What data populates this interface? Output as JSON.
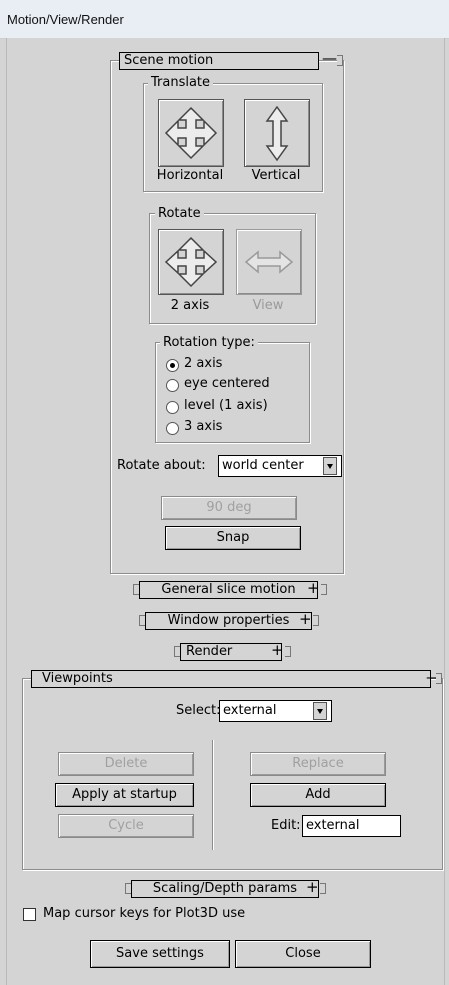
{
  "window": {
    "title": "Motion/View/Render"
  },
  "scene_motion": {
    "header": "Scene motion",
    "toggle": "—",
    "translate": {
      "title": "Translate",
      "horizontal": "Horizontal",
      "vertical": "Vertical"
    },
    "rotate": {
      "title": "Rotate",
      "two_axis": "2 axis",
      "view": "View"
    },
    "rotation_type": {
      "title": "Rotation type:",
      "options": [
        "2 axis",
        "eye centered",
        "level (1 axis)",
        "3 axis"
      ],
      "selected": "2 axis"
    },
    "rotate_about": {
      "label": "Rotate about:",
      "value": "world center"
    },
    "buttons": {
      "ninety_deg": "90 deg",
      "snap": "Snap"
    }
  },
  "collapsed_panels": {
    "general_slice_motion": "General slice motion",
    "window_properties": "Window properties",
    "render": "Render",
    "plus": "+"
  },
  "viewpoints": {
    "header": "Viewpoints",
    "toggle": "—",
    "select_label": "Select:",
    "select_value": "external",
    "buttons": {
      "delete": "Delete",
      "apply_at_startup": "Apply at startup",
      "cycle": "Cycle",
      "replace": "Replace",
      "add": "Add"
    },
    "edit_label": "Edit:",
    "edit_value": "external"
  },
  "scaling_depth": {
    "label": "Scaling/Depth params",
    "plus": "+"
  },
  "map_cursor_keys": {
    "label": "Map cursor keys for Plot3D use",
    "checked": false
  },
  "footer": {
    "save_settings": "Save settings",
    "close": "Close"
  }
}
